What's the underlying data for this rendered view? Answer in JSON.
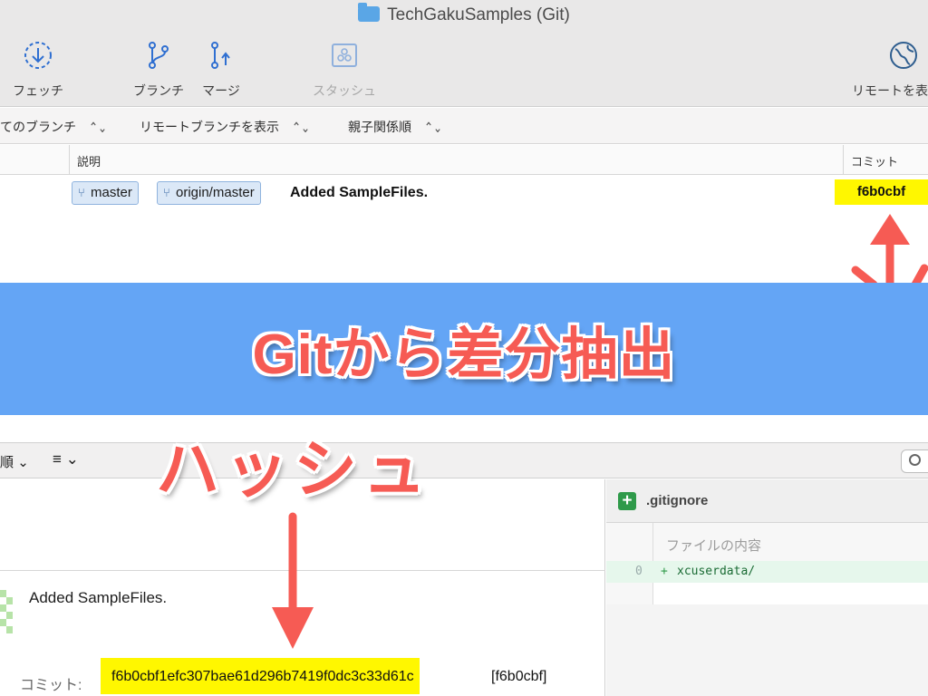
{
  "window": {
    "title": "TechGakuSamples (Git)"
  },
  "toolbar": {
    "fetch": "フェッチ",
    "branch": "ブランチ",
    "merge": "マージ",
    "stash": "スタッシュ",
    "remote": "リモートを表"
  },
  "filters": {
    "branches": "てのブランチ",
    "remote_branches": "リモートブランチを表示",
    "order": "親子関係順"
  },
  "columns": {
    "description": "説明",
    "commit": "コミット"
  },
  "commit_row": {
    "refs": [
      "master",
      "origin/master"
    ],
    "message": "Added SampleFiles.",
    "short_hash": "f6b0cbf"
  },
  "banner": {
    "text": "Gitから差分抽出"
  },
  "annotation": {
    "label": "ハッシュ",
    "color": "#f65b54"
  },
  "lower_toolbar": {
    "sort": "順",
    "list_icon": "≡"
  },
  "details": {
    "message": "Added SampleFiles.",
    "commit_label": "コミット:",
    "full_hash": "f6b0cbf1efc307bae61d296b7419f0dc3c33d61c",
    "short_hash_bracket": "[f6b0cbf]"
  },
  "diff": {
    "file_name": ".gitignore",
    "hunk_header": "ファイルの内容",
    "line_number": "0",
    "line_marker": "+",
    "line_code": "xcuserdata/"
  },
  "colors": {
    "highlight": "#fff700",
    "banner": "#64a5f5",
    "accent": "#f65b54"
  }
}
